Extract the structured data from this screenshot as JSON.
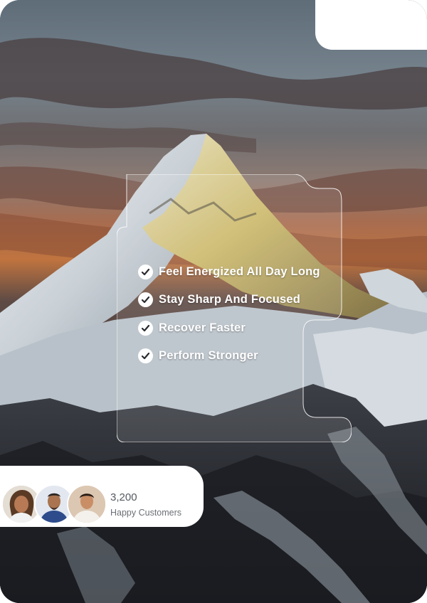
{
  "benefits": [
    "Feel Energized All Day Long",
    "Stay Sharp And Focused",
    "Recover Faster",
    "Perform Stronger"
  ],
  "social_proof": {
    "count": "3,200",
    "caption": "Happy Customers"
  },
  "icons": {
    "check": "check-circle-icon"
  },
  "colors": {
    "panel": "#ffffff",
    "text_light": "#ffffff",
    "text_muted": "#555a60"
  }
}
